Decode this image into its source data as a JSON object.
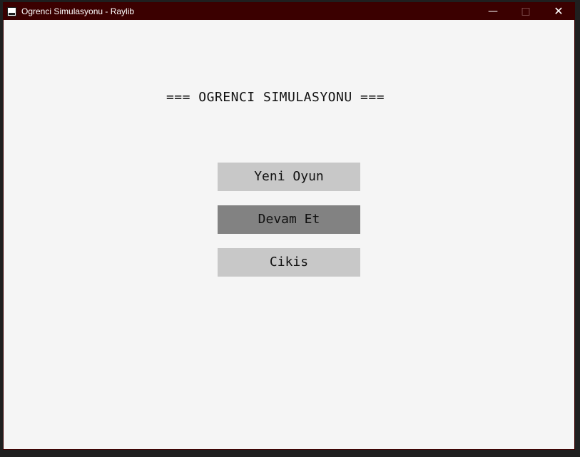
{
  "window": {
    "title": "Ogrenci Simulasyonu - Raylib",
    "icon": "raylib-icon",
    "controls": {
      "minimize_glyph": "—",
      "maximize_glyph": "□",
      "close_glyph": "✕"
    }
  },
  "menu": {
    "title": "=== OGRENCI SIMULASYONU ===",
    "buttons": [
      {
        "label": "Yeni Oyun",
        "color": "#c8c8c8"
      },
      {
        "label": "Devam Et",
        "color": "#828282"
      },
      {
        "label": "Cikis",
        "color": "#c8c8c8"
      }
    ]
  },
  "colors": {
    "titlebar": "#3b0000",
    "background": "#f5f5f5",
    "text": "#111111"
  }
}
